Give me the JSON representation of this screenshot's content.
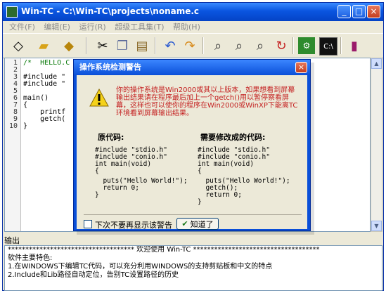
{
  "window": {
    "title": "Win-TC - C:\\Win-TC\\projects\\noname.c"
  },
  "menu": {
    "items": [
      "文件(F)",
      "编辑(E)",
      "运行(R)",
      "超级工具集(T)",
      "帮助(H)"
    ]
  },
  "editor": {
    "line_numbers": [
      "1",
      "2",
      "3",
      "4",
      "5",
      "6",
      "7",
      "8",
      "9",
      "10"
    ],
    "lines": [
      "/*  HELLO.C -- Hello, world */",
      "",
      "#include \"",
      "#include \"",
      "",
      "main()",
      "{",
      "    printf",
      "    getch(",
      "}"
    ]
  },
  "dialog": {
    "title": "操作系统检测警告",
    "message": "你的操作系统是Win2000或其以上版本，如果想看到屏幕输出结果请在程序最后加上一个getch()用以暂停察看屏幕，这样也可以使你的程序在Win2000或WinXP下能离TC环境看到屏幕输出结果。",
    "original_header": "原代码:",
    "modified_header": "需要修改成的代码:",
    "original_code": [
      "#include \"stdio.h\"",
      "#include \"conio.h\"",
      "int main(void)",
      "{",
      "  puts(\"Hello World!\");",
      "  return 0;",
      "}"
    ],
    "modified_code": [
      "#include \"stdio.h\"",
      "#include \"conio.h\"",
      "int main(void)",
      "{",
      "  puts(\"Hello World!\");",
      "  getch();",
      "  return 0;",
      "}"
    ],
    "checkbox_label": "下次不要再显示该警告",
    "ok_label": "知道了"
  },
  "output": {
    "header": "输出",
    "lines": [
      "************************************ 欢迎使用 Win-TC ************************************",
      "",
      "软件主要特色:",
      "1.在WINDOWS下编辑TC代码，可以充分利用WINDOWS的支持剪贴板和中文的特点",
      "2.Include和Lib路径自动定位，告别TC设置路径的历史"
    ]
  },
  "icons": {
    "title_bar": [
      "minimize-icon",
      "maximize-icon",
      "close-icon"
    ],
    "toolbar": [
      "new-icon",
      "open-icon",
      "save-icon",
      "cut-icon",
      "copy-icon",
      "paste-icon",
      "undo-icon",
      "redo-icon",
      "find-icon",
      "find-next-icon",
      "replace-icon",
      "refresh-icon",
      "compile-icon",
      "run-icon",
      "help-book-icon"
    ],
    "dialog": [
      "warning-icon",
      "check-icon"
    ]
  },
  "colors": {
    "title_bar": "#0a55e0",
    "message_text": "#c42020",
    "window_bg": "#ece9d8"
  }
}
